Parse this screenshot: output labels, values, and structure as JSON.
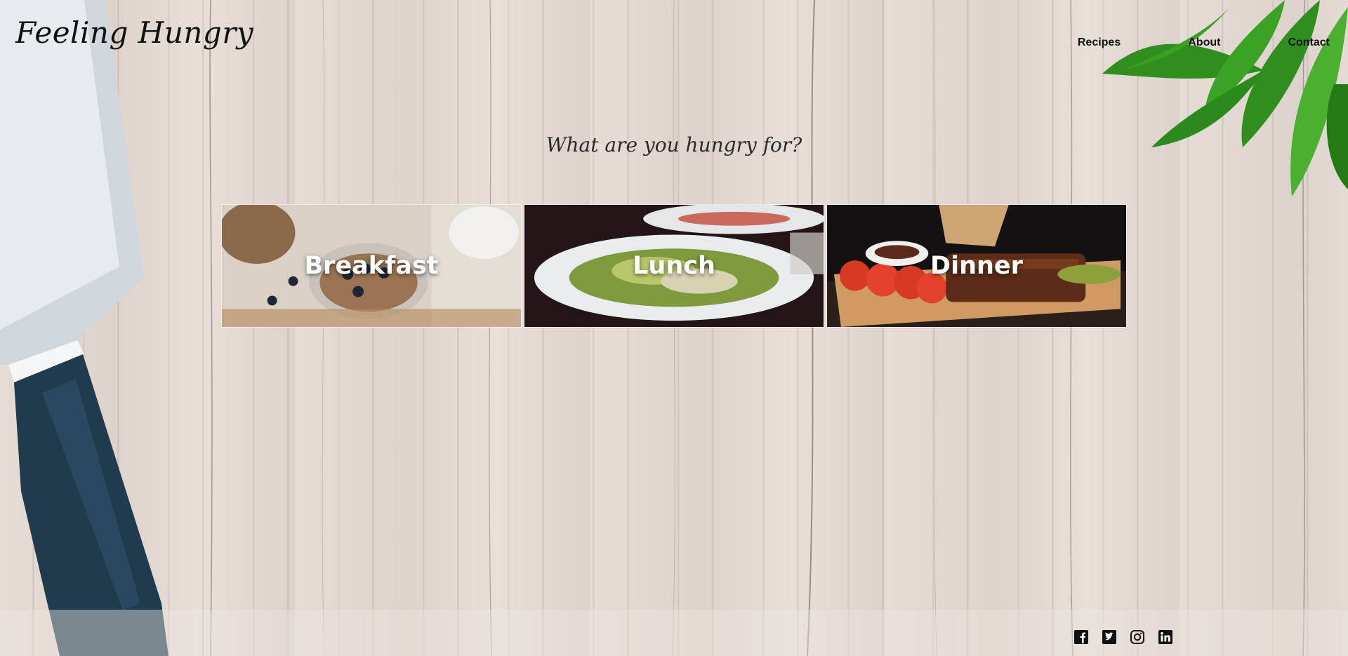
{
  "brand": {
    "logo": "Feeling Hungry"
  },
  "nav": {
    "items": [
      "Recipes",
      "About",
      "Contact"
    ]
  },
  "hero": {
    "question": "What are you hungry for?"
  },
  "categories": [
    {
      "label": "Breakfast"
    },
    {
      "label": "Lunch"
    },
    {
      "label": "Dinner"
    }
  ],
  "footer": {
    "social_icons": [
      "facebook-icon",
      "twitter-icon",
      "instagram-icon",
      "linkedin-icon"
    ]
  },
  "colors": {
    "text_dark": "#111111",
    "card_label": "#ffffff",
    "knife_handle": "#1f3b4d",
    "herb_green": "#2f8f1e",
    "wood": "#e4dad4"
  }
}
